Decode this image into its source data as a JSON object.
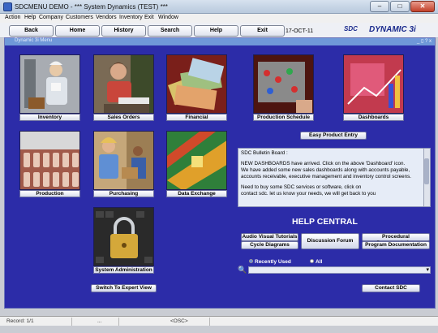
{
  "window": {
    "title": "SDCMENU DEMO - *** System Dynamics (TEST) ***"
  },
  "menu": [
    "Action",
    "Help",
    "Company",
    "Customers",
    "Vendors",
    "Inventory",
    "Exit",
    "Window"
  ],
  "toolbar": {
    "buttons": [
      "Back",
      "Home",
      "History",
      "Search",
      "Help",
      "Exit"
    ],
    "date": "17-OCT-11"
  },
  "brand": {
    "sdc": "SDC",
    "dynamic": "DYNAMIC 3i"
  },
  "subwindow": {
    "title": "Dynamic 3i Menu",
    "controls": "_ ▯ ? x"
  },
  "tiles": [
    {
      "label": "Inventory"
    },
    {
      "label": "Sales Orders"
    },
    {
      "label": "Financial"
    },
    {
      "label": "Production Schedule"
    },
    {
      "label": "Dashboards"
    },
    {
      "label": "Production"
    },
    {
      "label": "Purchasing"
    },
    {
      "label": "Data Exchange"
    },
    {
      "label": "System Administration"
    }
  ],
  "easy_entry": "Easy Product Entry",
  "bulletin": {
    "heading": "SDC Bulletin Board :",
    "lines": [
      "NEW DASHBOARDS have arrived. Click on the above 'Dashboard' icon.",
      "We have added some new sales dashboards along with accounts payable,",
      "accounts receivable, executive management and inventory control screens.",
      "Need to buy some SDC services or software, click on",
      "contact sdc. let us know your needs, we will get back to you"
    ]
  },
  "help_central": {
    "title": "HELP CENTRAL",
    "audio": "Audio Visual Tutorials",
    "cycle": "Cycle Diagrams",
    "forum": "Discussion Forum",
    "procedural": "Procedural Documentation",
    "program": "Program Documentation"
  },
  "filter": {
    "recent": "Recently Used",
    "all": "All"
  },
  "expert_view": "Switch To Expert View",
  "contact": "Contact SDC",
  "status": {
    "record": "Record: 1/1",
    "dots": "...",
    "osc": "<OSC>"
  }
}
